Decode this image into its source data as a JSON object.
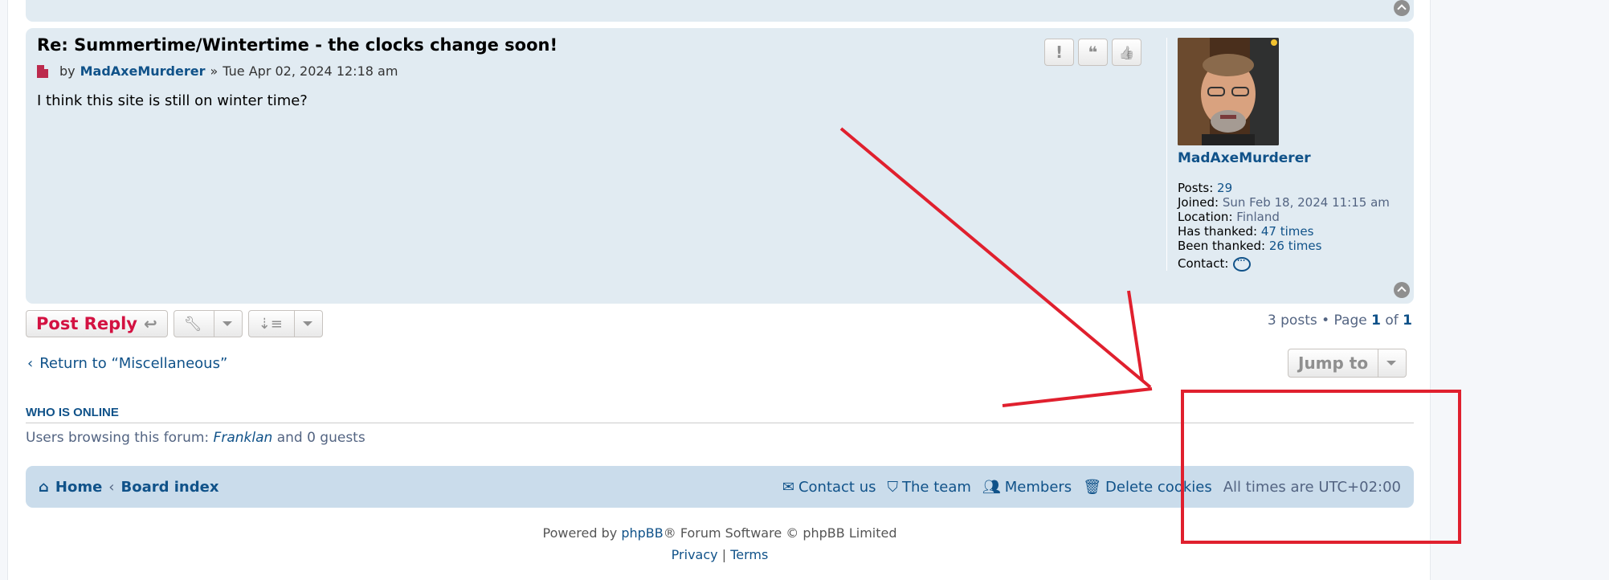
{
  "post": {
    "title": "Re: Summertime/Wintertime - the clocks change soon!",
    "by_label": "by",
    "author": "MadAxeMurderer",
    "separator": "»",
    "date": "Tue Apr 02, 2024 12:18 am",
    "body": "I think this site is still on winter time?",
    "buttons": [
      "!",
      "❝",
      "👍"
    ]
  },
  "profile": {
    "name": "MadAxeMurderer",
    "posts_label": "Posts:",
    "posts": "29",
    "joined_label": "Joined:",
    "joined": "Sun Feb 18, 2024 11:15 am",
    "location_label": "Location:",
    "location": "Finland",
    "thanked_label": "Has thanked:",
    "thanked": "47 times",
    "been_thanked_label": "Been thanked:",
    "been_thanked": "26 times",
    "contact_label": "Contact:"
  },
  "actions": {
    "post_reply": "Post Reply",
    "pagination_text": "3 posts • Page",
    "page_current": "1",
    "of": "of",
    "page_total": "1",
    "return": "Return to “Miscellaneous”",
    "jump_to": "Jump to"
  },
  "who_online": {
    "title": "WHO IS ONLINE",
    "prefix": "Users browsing this forum:",
    "user": "Franklan",
    "suffix": "and 0 guests"
  },
  "navbar": {
    "home": "Home",
    "board_index": "Board index",
    "contact": "Contact us",
    "team": "The team",
    "members": "Members",
    "delete_cookies": "Delete cookies",
    "timezone": "All times are UTC+02:00"
  },
  "footer": {
    "powered_by": "Powered by",
    "phpbb": "phpBB",
    "software": "® Forum Software © phpBB Limited",
    "privacy": "Privacy",
    "sep": "|",
    "terms": "Terms"
  },
  "colors": {
    "link": "#105289",
    "post_bg": "#e1ebf2",
    "navbar_bg": "#cadceb",
    "reply_red": "#d31141",
    "annotation_red": "#e0202e"
  }
}
